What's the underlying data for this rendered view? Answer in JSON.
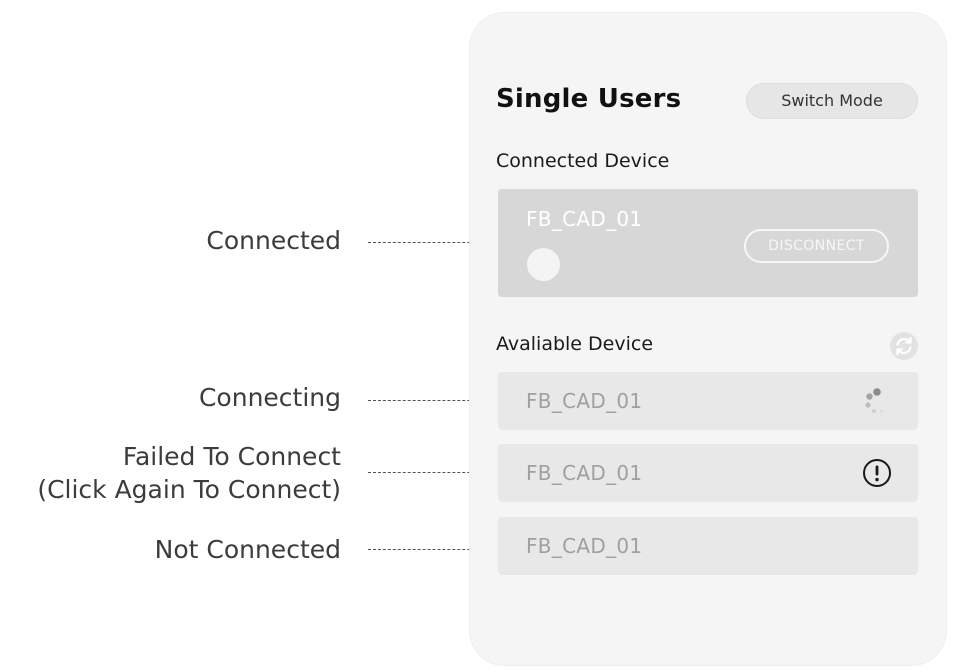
{
  "annotations": {
    "connected": "Connected",
    "connecting": "Connecting",
    "failed_line1": "Failed To Connect",
    "failed_line2": "(Click Again To Connect)",
    "not_connected": "Not Connected"
  },
  "header": {
    "title": "Single Users",
    "switch_mode_label": "Switch Mode"
  },
  "connected_section": {
    "heading": "Connected Device",
    "device_name": "FB_CAD_01",
    "disconnect_label": "DISCONNECT"
  },
  "available_section": {
    "heading": "Avaliable Device",
    "refresh_icon": "refresh-icon",
    "devices": [
      {
        "name": "FB_CAD_01",
        "state": "connecting",
        "icon": "spinner-icon"
      },
      {
        "name": "FB_CAD_01",
        "state": "failed",
        "icon": "alert-circle-icon"
      },
      {
        "name": "FB_CAD_01",
        "state": "not-connected",
        "icon": ""
      }
    ]
  },
  "colors": {
    "panel_bg": "#f5f5f5",
    "connected_card_bg": "#d7d7d7",
    "device_card_bg": "#e8e8e8",
    "muted_text": "#a0a0a0"
  }
}
